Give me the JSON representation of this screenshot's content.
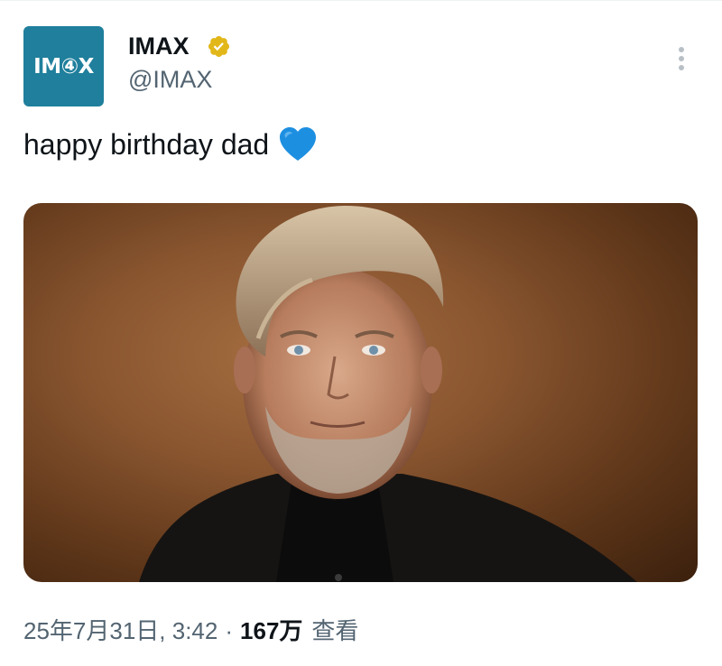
{
  "author": {
    "avatar_text": "IM④X",
    "display_name": "IMAX",
    "handle": "@IMAX",
    "verified": true,
    "verified_color": "#e2b719",
    "avatar_color": "#1f7f9c"
  },
  "tweet": {
    "text": "happy birthday dad",
    "emoji_icon": "blue-heart-icon",
    "heart_color": "#1d8fe1"
  },
  "meta": {
    "timestamp": "25年7月31日, 3:42",
    "separator": "·",
    "views_count": "167万",
    "views_label": "查看"
  },
  "more_icon": "vertical-dots-icon"
}
